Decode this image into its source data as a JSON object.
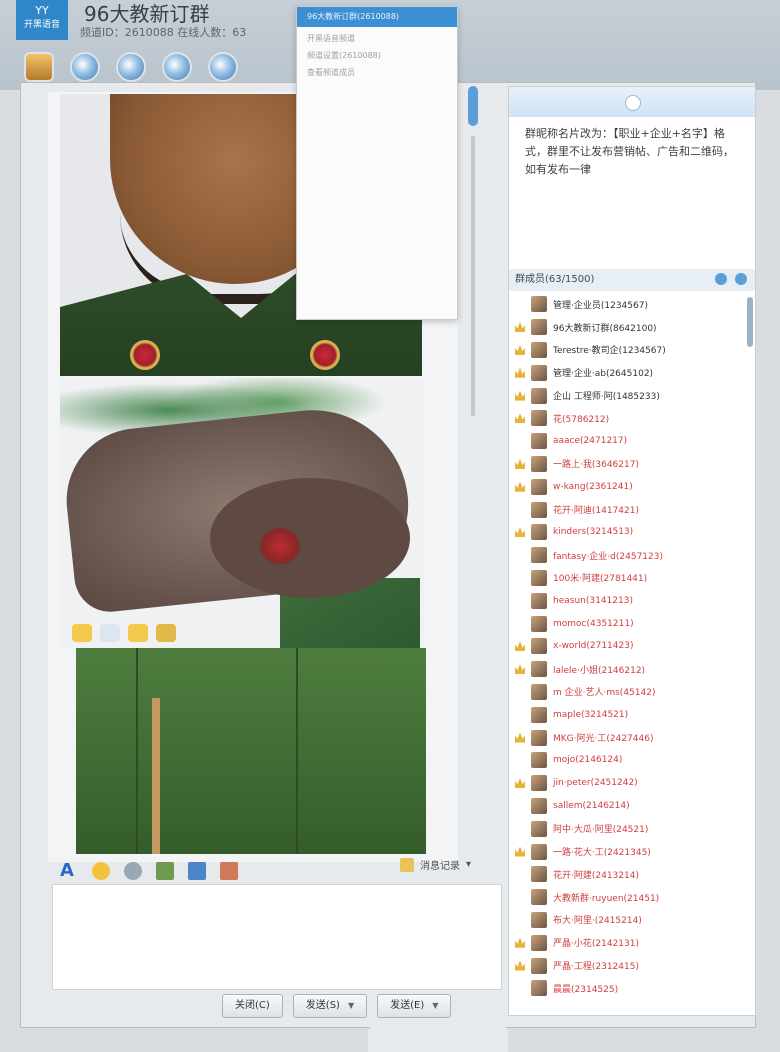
{
  "app": {
    "logo_line1": "YY",
    "logo_line2": "开黑语音",
    "title": "96大教新订群",
    "subtitle": "频道ID：2610088   在线人数：63"
  },
  "dropdown": {
    "selected": "96大教新订群(2610088)",
    "options": [
      "开黑语音频道",
      "频道设置(2610088)",
      "查看频道成员"
    ]
  },
  "announcement": "群昵称名片改为：【职业+企业+名字】格式，群里不让发布营销帖、广告和二维码，如有发布一律",
  "members_header": "群成员(63/1500)",
  "members": [
    {
      "name": "管理·企业员(1234567)",
      "admin": true,
      "crown": false
    },
    {
      "name": "96大教新订群(8642100)",
      "admin": true,
      "crown": true
    },
    {
      "name": "Terestre·教司企(1234567)",
      "admin": true,
      "crown": true
    },
    {
      "name": "管理·企业·ab(2645102)",
      "admin": true,
      "crown": true
    },
    {
      "name": "企山 工程师·阿(1485233)",
      "admin": true,
      "crown": true
    },
    {
      "name": "花(5786212)",
      "admin": false,
      "crown": true
    },
    {
      "name": "aaace(2471217)",
      "admin": false,
      "crown": false
    },
    {
      "name": "一路上·我(3646217)",
      "admin": false,
      "crown": true
    },
    {
      "name": "w-kang(2361241)",
      "admin": false,
      "crown": true
    },
    {
      "name": "花开·阿迪(1417421)",
      "admin": false,
      "crown": false
    },
    {
      "name": "kinders(3214513)",
      "admin": false,
      "crown": true
    },
    {
      "name": "fantasy·企业·d(2457123)",
      "admin": false,
      "crown": false
    },
    {
      "name": "100米·阿建(2781441)",
      "admin": false,
      "crown": false
    },
    {
      "name": "heasun(3141213)",
      "admin": false,
      "crown": false
    },
    {
      "name": "momoc(4351211)",
      "admin": false,
      "crown": false
    },
    {
      "name": "x-world(2711423)",
      "admin": false,
      "crown": true
    },
    {
      "name": "lalele·小姐(2146212)",
      "admin": false,
      "crown": true
    },
    {
      "name": "m 企业·艺人·ms(45142)",
      "admin": false,
      "crown": false
    },
    {
      "name": "maple(3214521)",
      "admin": false,
      "crown": false
    },
    {
      "name": "MKG·阿光·工(2427446)",
      "admin": false,
      "crown": true
    },
    {
      "name": "mojo(2146124)",
      "admin": false,
      "crown": false
    },
    {
      "name": "jin·peter(2451242)",
      "admin": false,
      "crown": true
    },
    {
      "name": "sallem(2146214)",
      "admin": false,
      "crown": false
    },
    {
      "name": "阿中·大瓜·阿里(24521)",
      "admin": false,
      "crown": false
    },
    {
      "name": "一路·花大·工(2421345)",
      "admin": false,
      "crown": true
    },
    {
      "name": "花开·阿建(2413214)",
      "admin": false,
      "crown": false
    },
    {
      "name": "大教新群·ruyuen(21451)",
      "admin": false,
      "crown": false
    },
    {
      "name": "布大·阿里·(2415214)",
      "admin": false,
      "crown": false
    },
    {
      "name": "严晶·小花(2142131)",
      "admin": false,
      "crown": true
    },
    {
      "name": "严晶·工程(2312415)",
      "admin": false,
      "crown": true
    },
    {
      "name": "晨晨(2314525)",
      "admin": false,
      "crown": false
    }
  ],
  "toolbar_right": "消息记录",
  "buttons": {
    "close": "关闭(C)",
    "send": "发送(S)",
    "send_mode": "发送(E)"
  }
}
